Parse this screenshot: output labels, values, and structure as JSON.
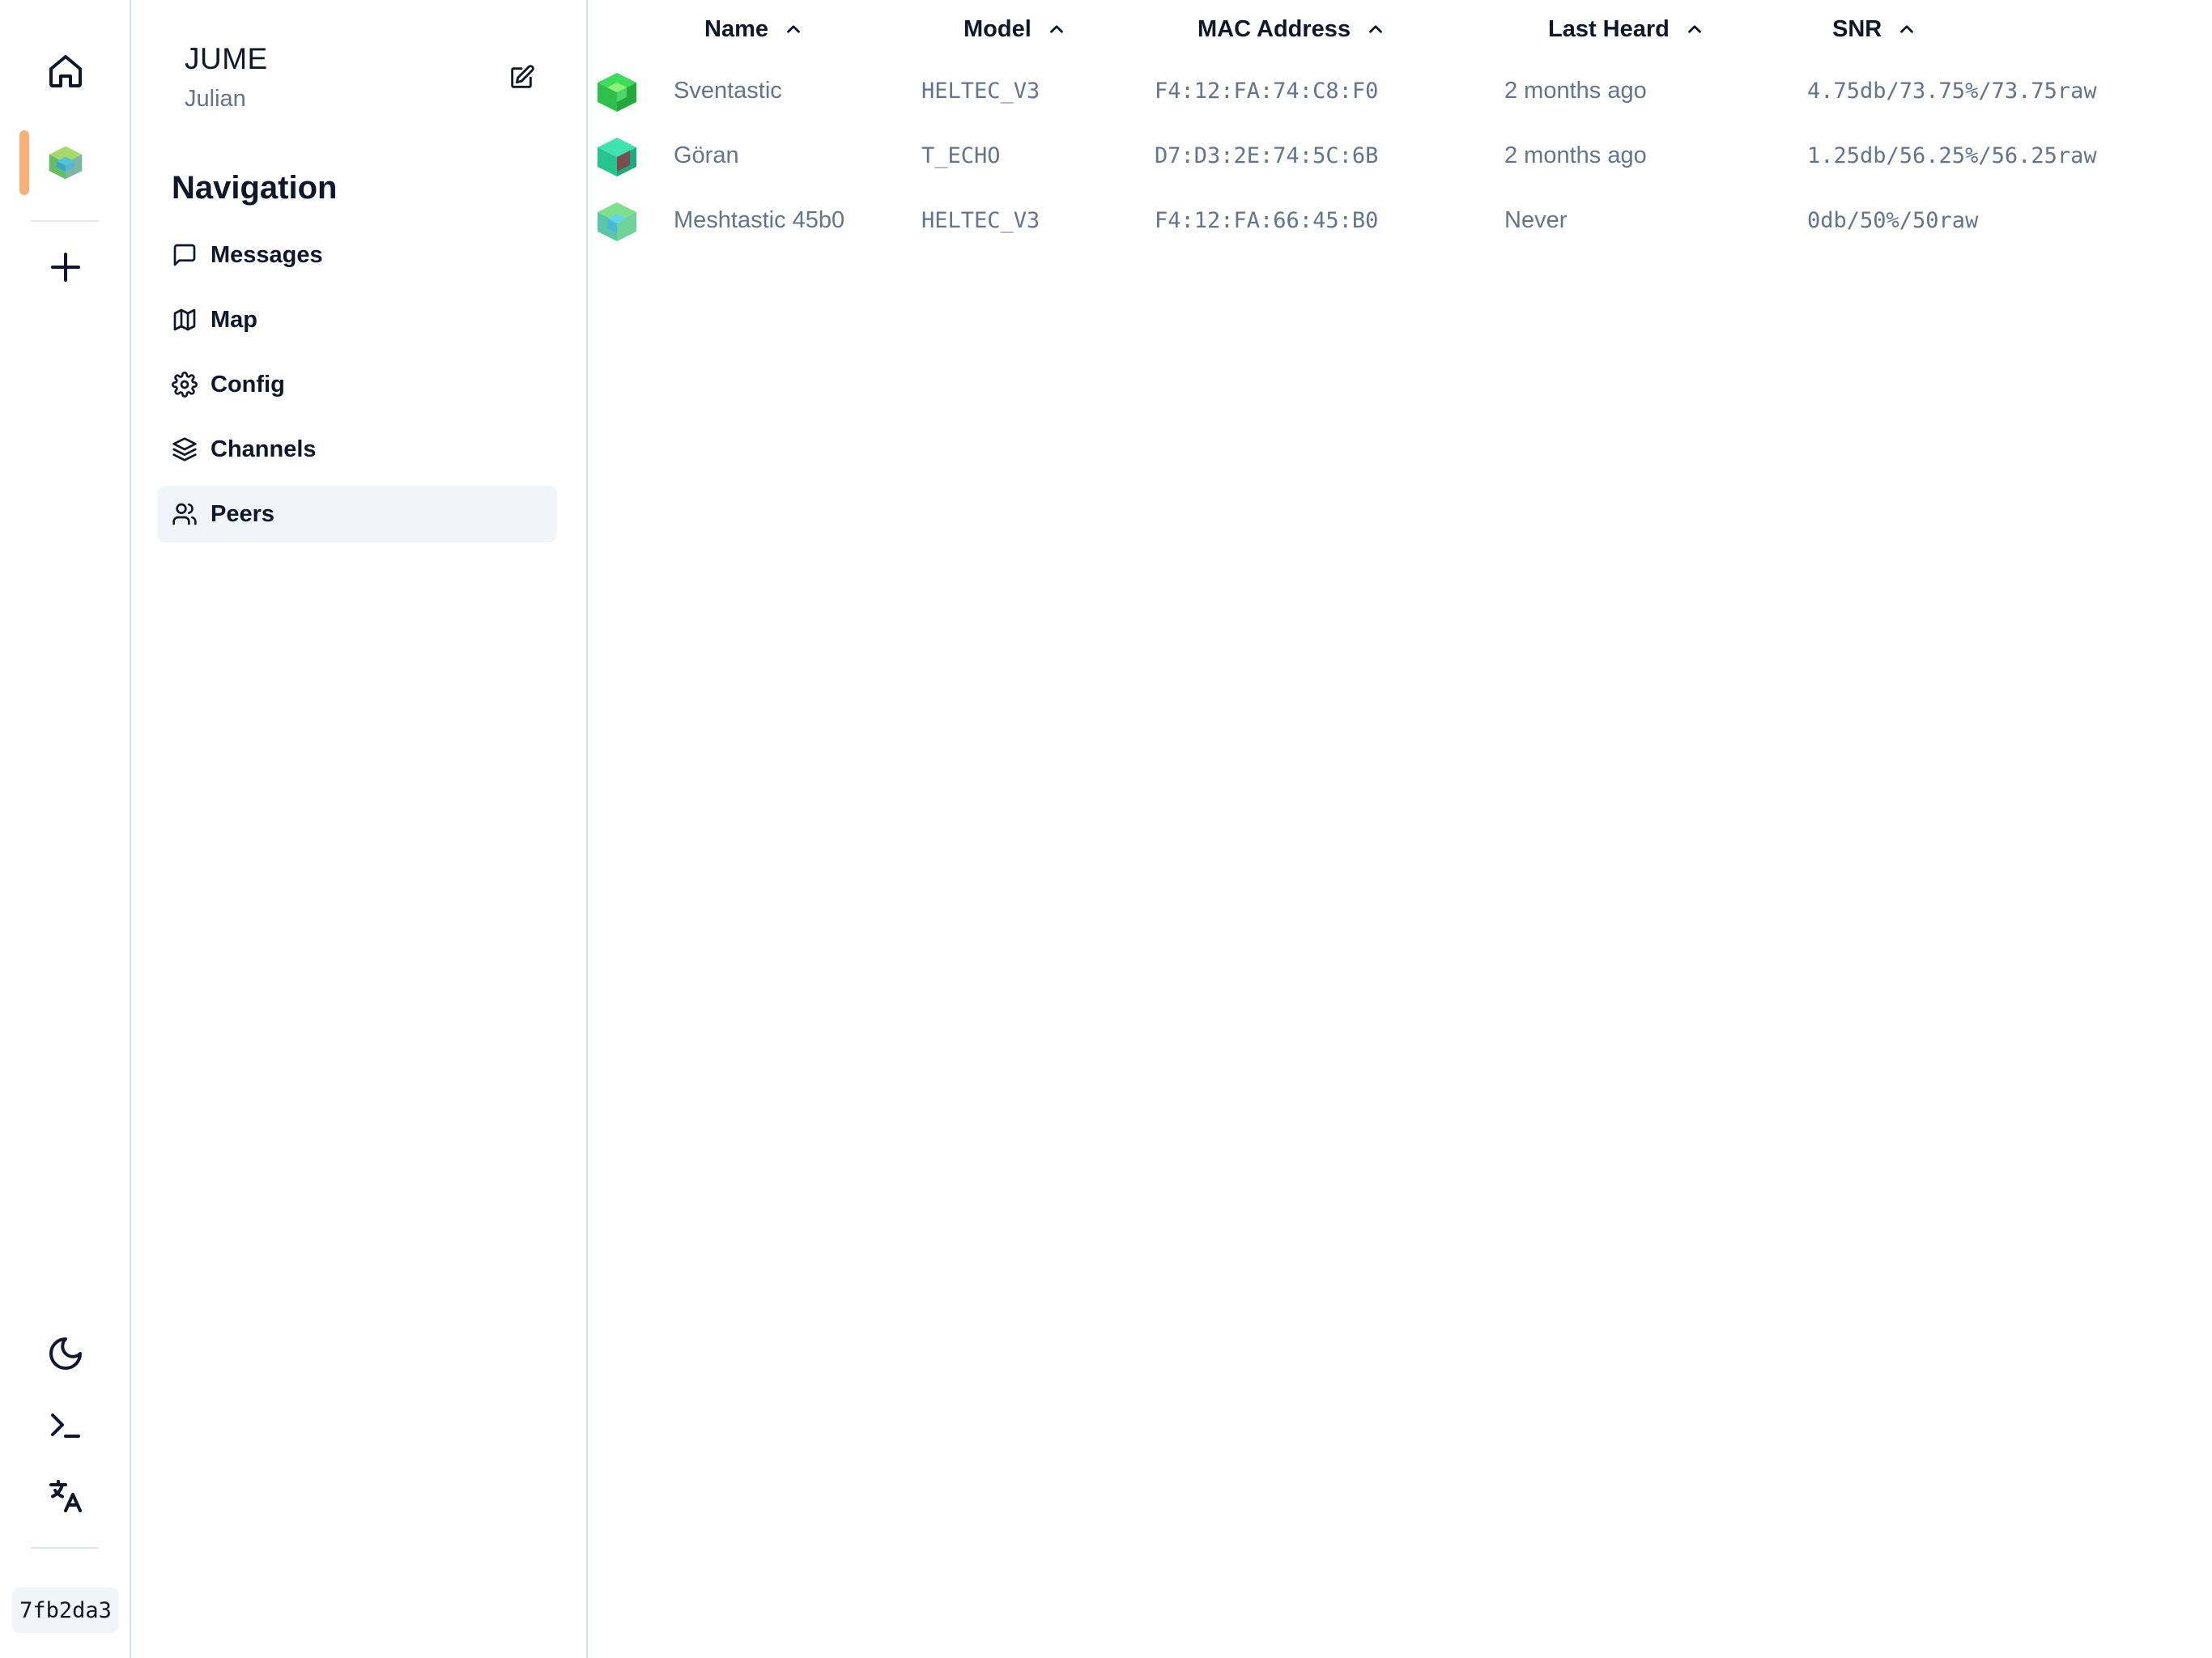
{
  "rail": {
    "commit": "7fb2da3"
  },
  "sidebar": {
    "node_short": "JUME",
    "node_long": "Julian",
    "nav_title": "Navigation",
    "items": [
      {
        "label": "Messages",
        "icon": "message-square-icon"
      },
      {
        "label": "Map",
        "icon": "map-icon"
      },
      {
        "label": "Config",
        "icon": "gear-icon"
      },
      {
        "label": "Channels",
        "icon": "layers-icon"
      },
      {
        "label": "Peers",
        "icon": "users-icon",
        "active": true
      }
    ]
  },
  "peers": {
    "columns": [
      "Name",
      "Model",
      "MAC Address",
      "Last Heard",
      "SNR"
    ],
    "rows": [
      {
        "name": "Sventastic",
        "model": "HELTEC_V3",
        "mac": "F4:12:FA:74:C8:F0",
        "last_heard": "2 months ago",
        "snr": "4.75db/73.75%/73.75raw"
      },
      {
        "name": "Göran",
        "model": "T_ECHO",
        "mac": "D7:D3:2E:74:5C:6B",
        "last_heard": "2 months ago",
        "snr": "1.25db/56.25%/56.25raw"
      },
      {
        "name": "Meshtastic 45b0",
        "model": "HELTEC_V3",
        "mac": "F4:12:FA:66:45:B0",
        "last_heard": "Never",
        "snr": "0db/50%/50raw"
      }
    ]
  },
  "colors": {
    "active_marker": "#f6b07a",
    "active_nav_bg": "#f1f5f9",
    "text_primary": "#0f172a",
    "text_muted": "#64748b",
    "border": "#dbe1e8"
  }
}
